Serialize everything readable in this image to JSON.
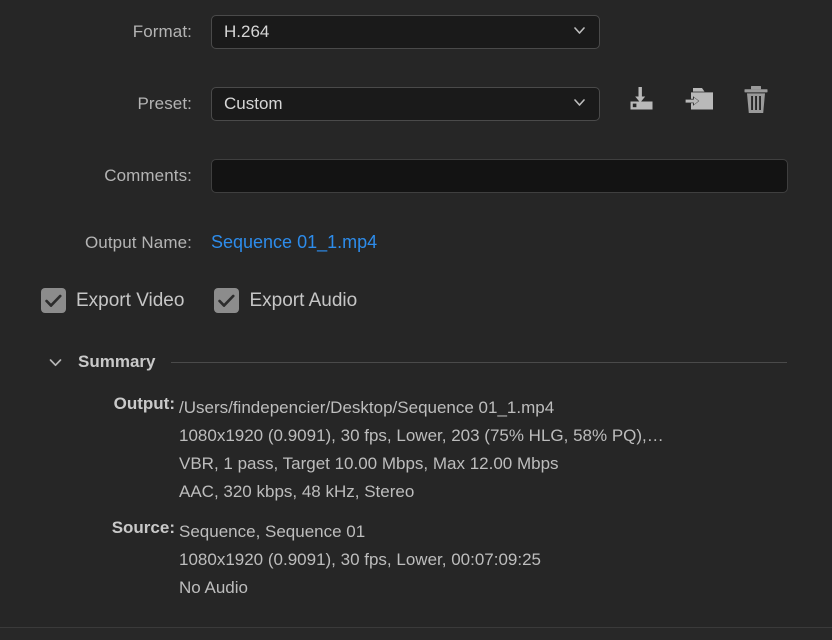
{
  "panel": {
    "background_color": "#262626",
    "link_color": "#2d8ceb"
  },
  "fields": {
    "format": {
      "label": "Format:",
      "value": "H.264",
      "chevron_icon": "chevron-down-icon"
    },
    "preset": {
      "label": "Preset:",
      "value": "Custom",
      "chevron_icon": "chevron-down-icon"
    },
    "comments": {
      "label": "Comments:",
      "value": "",
      "placeholder": ""
    },
    "output_name": {
      "label": "Output Name:",
      "value": "Sequence 01_1.mp4"
    }
  },
  "preset_actions": [
    {
      "name": "save-preset-icon",
      "tooltip": "Save Preset"
    },
    {
      "name": "import-preset-icon",
      "tooltip": "Import Preset"
    },
    {
      "name": "delete-preset-icon",
      "tooltip": "Delete Preset"
    }
  ],
  "checkboxes": [
    {
      "label": "Export Video",
      "checked": true
    },
    {
      "label": "Export Audio",
      "checked": true
    }
  ],
  "summary": {
    "title": "Summary",
    "expanded": true,
    "disclosure_icon": "chevron-down-icon",
    "output": {
      "key": "Output:",
      "lines": [
        "/Users/findepencier/Desktop/Sequence 01_1.mp4",
        "1080x1920 (0.9091), 30 fps, Lower, 203 (75% HLG, 58% PQ),…",
        "VBR, 1 pass, Target 10.00 Mbps, Max 12.00 Mbps",
        "AAC, 320 kbps, 48 kHz, Stereo"
      ]
    },
    "source": {
      "key": "Source:",
      "lines": [
        "Sequence, Sequence 01",
        "1080x1920 (0.9091), 30 fps, Lower, 00:07:09:25",
        "No Audio"
      ]
    }
  }
}
